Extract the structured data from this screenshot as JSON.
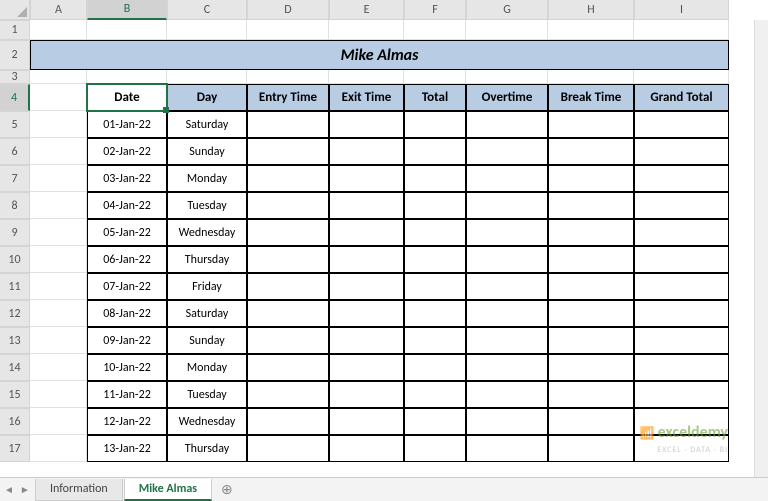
{
  "cols": [
    "A",
    "B",
    "C",
    "D",
    "E",
    "F",
    "G",
    "H",
    "I"
  ],
  "rows": [
    "1",
    "2",
    "3",
    "4",
    "5",
    "6",
    "7",
    "8",
    "9",
    "10",
    "11",
    "12",
    "13",
    "14",
    "15",
    "16",
    "17"
  ],
  "title": "Mike Almas",
  "headers": [
    "Date",
    "Day",
    "Entry Time",
    "Exit Time",
    "Total",
    "Overtime",
    "Break Time",
    "Grand Total"
  ],
  "data": [
    {
      "date": "01-Jan-22",
      "day": "Saturday"
    },
    {
      "date": "02-Jan-22",
      "day": "Sunday"
    },
    {
      "date": "03-Jan-22",
      "day": "Monday"
    },
    {
      "date": "04-Jan-22",
      "day": "Tuesday"
    },
    {
      "date": "05-Jan-22",
      "day": "Wednesday"
    },
    {
      "date": "06-Jan-22",
      "day": "Thursday"
    },
    {
      "date": "07-Jan-22",
      "day": "Friday"
    },
    {
      "date": "08-Jan-22",
      "day": "Saturday"
    },
    {
      "date": "09-Jan-22",
      "day": "Sunday"
    },
    {
      "date": "10-Jan-22",
      "day": "Monday"
    },
    {
      "date": "11-Jan-22",
      "day": "Tuesday"
    },
    {
      "date": "12-Jan-22",
      "day": "Wednesday"
    },
    {
      "date": "13-Jan-22",
      "day": "Thursday"
    }
  ],
  "selected_col": "B",
  "selected_row": "4",
  "tabs": [
    "Information",
    "Mike Almas"
  ],
  "active_tab": 1,
  "watermark": {
    "brand": "exceldemy",
    "sub": "EXCEL · DATA · BI"
  }
}
